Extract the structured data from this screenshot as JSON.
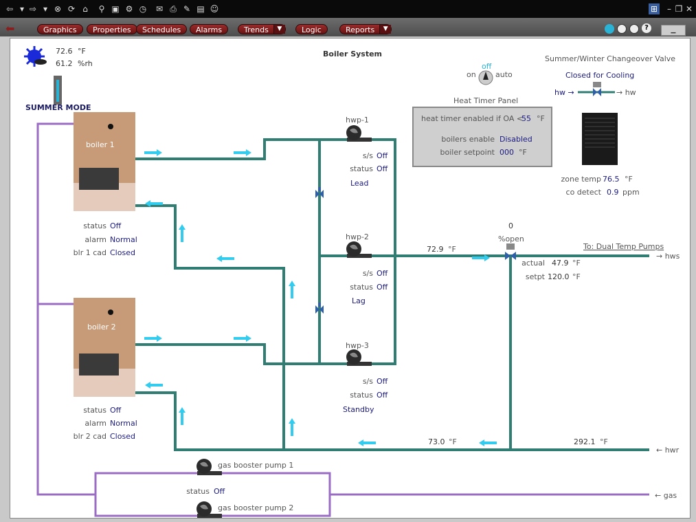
{
  "navbar": {
    "buttons": [
      "Graphics",
      "Properties",
      "Schedules",
      "Alarms",
      "Trends",
      "Logic",
      "Reports"
    ]
  },
  "weather": {
    "temp": "72.6",
    "temp_unit": "°F",
    "rh": "61.2",
    "rh_unit": "%rh",
    "mode": "SUMMER MODE"
  },
  "title": "Boiler System",
  "heat_timer": {
    "title": "Heat Timer Panel",
    "switch_on": "on",
    "switch_state": "off",
    "switch_auto": "auto",
    "enabled_label": "heat timer enabled if OA <",
    "enabled_value": "55",
    "enabled_unit": "°F",
    "boilers_label": "boilers enable",
    "boilers_value": "Disabled",
    "setpoint_label": "boiler setpoint",
    "setpoint_value": "000",
    "setpoint_unit": "°F"
  },
  "changeover": {
    "title": "Summer/Winter Changeover Valve",
    "status": "Closed for Cooling",
    "left": "hw →",
    "right": "→ hw"
  },
  "zone": {
    "temp_label": "zone temp",
    "temp_value": "76.5",
    "temp_unit": "°F",
    "co_label": "co detect",
    "co_value": "0.9",
    "co_unit": "ppm"
  },
  "boiler1": {
    "name": "boiler 1",
    "status_label": "status",
    "status": "Off",
    "alarm_label": "alarm",
    "alarm": "Normal",
    "cad_label": "blr 1 cad",
    "cad": "Closed"
  },
  "boiler2": {
    "name": "boiler 2",
    "status_label": "status",
    "status": "Off",
    "alarm_label": "alarm",
    "alarm": "Normal",
    "cad_label": "blr 2 cad",
    "cad": "Closed"
  },
  "pumps": [
    {
      "name": "hwp-1",
      "ss_label": "s/s",
      "ss": "Off",
      "status_label": "status",
      "status": "Off",
      "role": "Lead"
    },
    {
      "name": "hwp-2",
      "ss_label": "s/s",
      "ss": "Off",
      "status_label": "status",
      "status": "Off",
      "role": "Lag"
    },
    {
      "name": "hwp-3",
      "ss_label": "s/s",
      "ss": "Off",
      "status_label": "status",
      "status": "Off",
      "role": "Standby"
    }
  ],
  "mix_valve": {
    "open_value": "0",
    "open_label": "%open",
    "actual_label": "actual",
    "actual": "47.9",
    "actual_unit": "°F",
    "setpt_label": "setpt",
    "setpt": "120.0",
    "setpt_unit": "°F"
  },
  "supply": {
    "temp": "72.9",
    "temp_unit": "°F",
    "link": "To: Dual Temp Pumps",
    "out": "→ hws"
  },
  "return": {
    "temp": "73.0",
    "temp_unit": "°F",
    "temp2": "292.1",
    "temp2_unit": "°F",
    "in": "← hwr"
  },
  "gas": {
    "pump1": "gas booster pump 1",
    "pump2": "gas booster pump 2",
    "status_label": "status",
    "status": "Off",
    "in": "← gas"
  },
  "colors": {
    "pipe": "#2f7d73",
    "flow": "#33ccee",
    "gas_pipe": "#9b6cc4",
    "nav_btn": "#8a1e1e"
  }
}
